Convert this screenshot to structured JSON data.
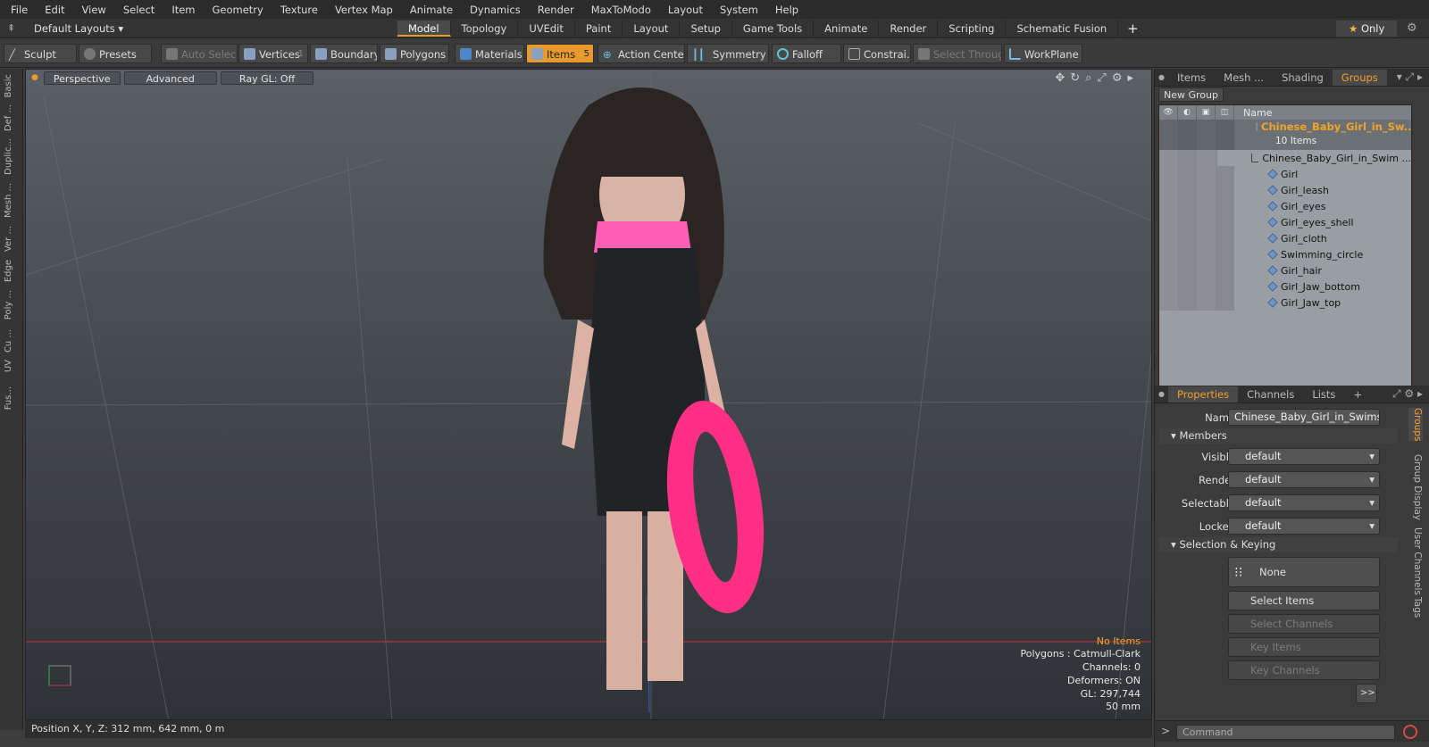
{
  "menu": [
    "File",
    "Edit",
    "View",
    "Select",
    "Item",
    "Geometry",
    "Texture",
    "Vertex Map",
    "Animate",
    "Dynamics",
    "Render",
    "MaxToModo",
    "Layout",
    "System",
    "Help"
  ],
  "layout": {
    "current": "Default Layouts",
    "tabs": [
      "Model",
      "Topology",
      "UVEdit",
      "Paint",
      "Layout",
      "Setup",
      "Game Tools",
      "Animate",
      "Render",
      "Scripting",
      "Schematic Fusion"
    ],
    "active_tab": "Model",
    "only_label": "Only"
  },
  "toolbar": {
    "sculpt": "Sculpt",
    "presets": "Presets",
    "auto_select": "Auto Select",
    "vertices": "Vertices",
    "vertices_count": "1",
    "boundary": "Boundary",
    "polygons": "Polygons",
    "materials": "Materials",
    "items": "Items",
    "items_count": "5",
    "action_center": "Action Center",
    "symmetry": "Symmetry",
    "falloff": "Falloff",
    "constraints": "Constrai...",
    "select_through": "Select Through",
    "workplane": "WorkPlane"
  },
  "left_tabs": [
    "Basic",
    "Def ...",
    "Duplic...",
    "Mesh ...",
    "Ver ...",
    "Edge",
    "Poly ...",
    "Cu ...",
    "UV",
    "Fus..."
  ],
  "viewport": {
    "perspective": "Perspective",
    "advanced": "Advanced",
    "raygl": "Ray GL: Off",
    "info": {
      "no_items": "No Items",
      "polygons": "Polygons : Catmull-Clark",
      "channels": "Channels: 0",
      "deformers": "Deformers: ON",
      "gl": "GL: 297,744",
      "focal": "50 mm"
    }
  },
  "status": "Position X, Y, Z:  312 mm, 642 mm, 0 m",
  "items_panel": {
    "tabs": [
      "Items",
      "Mesh ...",
      "Shading",
      "Groups"
    ],
    "active_tab": "Groups",
    "new_group": "New Group",
    "name_header": "Name",
    "group_name": "Chinese_Baby_Girl_in_Sw...",
    "group_count": "10 Items",
    "children": [
      "Chinese_Baby_Girl_in_Swim ...",
      "Girl",
      "Girl_leash",
      "Girl_eyes",
      "Girl_eyes_shell",
      "Girl_cloth",
      "Swimming_circle",
      "Girl_hair",
      "Girl_Jaw_bottom",
      "Girl_Jaw_top"
    ]
  },
  "properties": {
    "tabs": [
      "Properties",
      "Channels",
      "Lists"
    ],
    "active_tab": "Properties",
    "name_label": "Name",
    "name_value": "Chinese_Baby_Girl_in_Swimsuit_\\",
    "members_label": "Members",
    "visible_label": "Visible",
    "visible_value": "default",
    "render_label": "Render",
    "render_value": "default",
    "selectable_label": "Selectable",
    "selectable_value": "default",
    "locked_label": "Locked",
    "locked_value": "default",
    "selection_label": "Selection & Keying",
    "none": "None",
    "select_items": "Select Items",
    "select_channels": "Select Channels",
    "key_items": "Key Items",
    "key_channels": "Key Channels",
    "more": ">>",
    "side_tabs": [
      "Groups",
      "Group Display",
      "User Channels",
      "Tags"
    ],
    "command_placeholder": "Command"
  }
}
